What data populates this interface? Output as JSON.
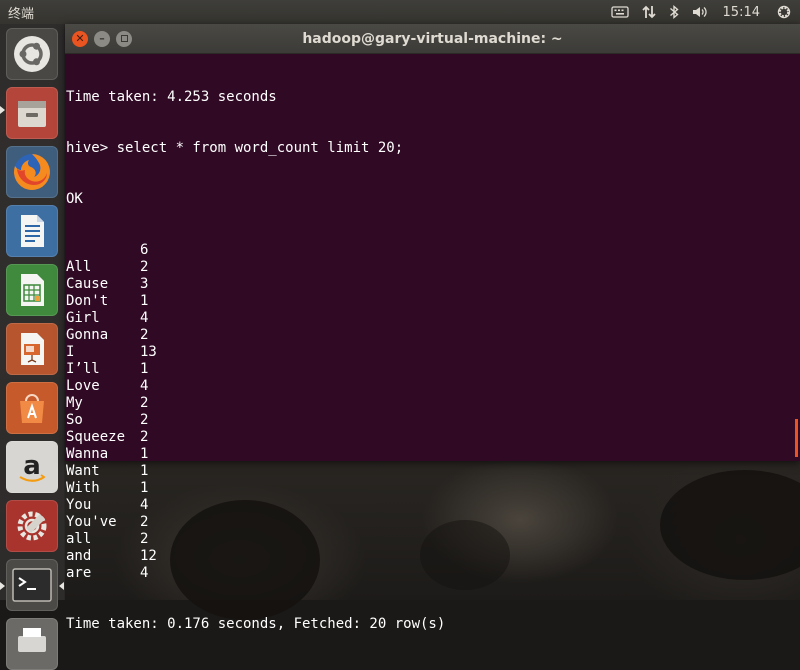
{
  "top_panel": {
    "app_title": "终端",
    "clock": "15:14",
    "icons": [
      "keyboard-icon",
      "network-updown-icon",
      "bluetooth-icon",
      "volume-icon",
      "settings-gear-icon"
    ]
  },
  "launcher": {
    "items": [
      {
        "name": "launcher-dash",
        "icon": "ubuntu-logo-icon"
      },
      {
        "name": "launcher-files",
        "icon": "file-cabinet-icon"
      },
      {
        "name": "launcher-firefox",
        "icon": "firefox-icon"
      },
      {
        "name": "launcher-writer",
        "icon": "writer-document-icon"
      },
      {
        "name": "launcher-calc",
        "icon": "calc-spreadsheet-icon"
      },
      {
        "name": "launcher-impress",
        "icon": "impress-presentation-icon"
      },
      {
        "name": "launcher-software",
        "icon": "software-bag-icon"
      },
      {
        "name": "launcher-amazon",
        "icon": "amazon-icon"
      },
      {
        "name": "launcher-system-settings",
        "icon": "system-settings-icon"
      },
      {
        "name": "launcher-terminal",
        "icon": "terminal-icon"
      },
      {
        "name": "launcher-printer",
        "icon": "printer-icon"
      }
    ]
  },
  "window": {
    "title": "hadoop@gary-virtual-machine: ~"
  },
  "terminal": {
    "line_time_taken_1": "Time taken: 4.253 seconds",
    "line_command": "hive> select * from word_count limit 20;",
    "line_ok": "OK",
    "rows": [
      {
        "word": "",
        "count": "6"
      },
      {
        "word": "All",
        "count": "2"
      },
      {
        "word": "Cause",
        "count": "3"
      },
      {
        "word": "Don't",
        "count": "1"
      },
      {
        "word": "Girl",
        "count": "4"
      },
      {
        "word": "Gonna",
        "count": "2"
      },
      {
        "word": "I",
        "count": "13"
      },
      {
        "word": "I’ll",
        "count": "1"
      },
      {
        "word": "Love",
        "count": "4"
      },
      {
        "word": "My",
        "count": "2"
      },
      {
        "word": "So",
        "count": "2"
      },
      {
        "word": "Squeeze",
        "count": "2"
      },
      {
        "word": "Wanna",
        "count": "1"
      },
      {
        "word": "Want",
        "count": "1"
      },
      {
        "word": "With",
        "count": "1"
      },
      {
        "word": "You",
        "count": "4"
      },
      {
        "word": "You've",
        "count": "2"
      },
      {
        "word": "all",
        "count": "2"
      },
      {
        "word": "and",
        "count": "12"
      },
      {
        "word": "are",
        "count": "4"
      }
    ],
    "line_time_taken_2": "Time taken: 0.176 seconds, Fetched: 20 row(s)"
  },
  "colors": {
    "terminal_bg": "#300a24",
    "accent": "#e95420",
    "panel_bg": "#3c3b37"
  }
}
